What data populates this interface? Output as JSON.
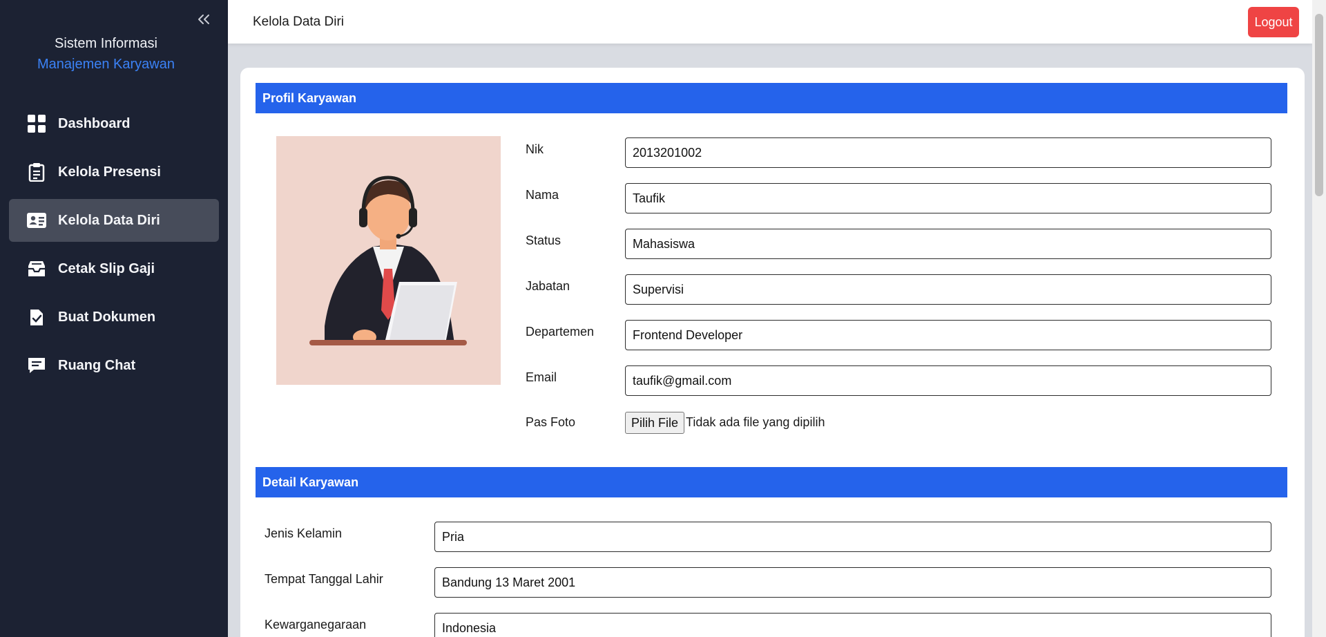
{
  "sidebar": {
    "collapse_icon": "double-chevron-left-icon",
    "brand_line1": "Sistem Informasi",
    "brand_line2": "Manajemen Karyawan",
    "items": [
      {
        "label": "Dashboard",
        "icon": "grid-icon",
        "active": false
      },
      {
        "label": "Kelola Presensi",
        "icon": "clipboard-icon",
        "active": false
      },
      {
        "label": "Kelola Data Diri",
        "icon": "id-card-icon",
        "active": true
      },
      {
        "label": "Cetak Slip Gaji",
        "icon": "inbox-tray-icon",
        "active": false
      },
      {
        "label": "Buat Dokumen",
        "icon": "document-check-icon",
        "active": false
      },
      {
        "label": "Ruang Chat",
        "icon": "chat-icon",
        "active": false
      }
    ]
  },
  "header": {
    "title": "Kelola Data Diri",
    "logout_label": "Logout"
  },
  "profile": {
    "section_title": "Profil Karyawan",
    "fields": {
      "nik": {
        "label": "Nik",
        "value": "2013201002"
      },
      "nama": {
        "label": "Nama",
        "value": "Taufik"
      },
      "status": {
        "label": "Status",
        "value": "Mahasiswa"
      },
      "jabatan": {
        "label": "Jabatan",
        "value": "Supervisi"
      },
      "departemen": {
        "label": "Departemen",
        "value": "Frontend Developer"
      },
      "email": {
        "label": "Email",
        "value": "taufik@gmail.com"
      }
    },
    "photo_field": {
      "label": "Pas Foto",
      "button_label": "Pilih File",
      "status_text": "Tidak ada file yang dipilih"
    }
  },
  "detail": {
    "section_title": "Detail Karyawan",
    "fields": {
      "jenis_kelamin": {
        "label": "Jenis Kelamin",
        "value": "Pria"
      },
      "ttl": {
        "label": "Tempat Tanggal Lahir",
        "value": "Bandung 13 Maret 2001"
      },
      "kewarganegaraan": {
        "label": "Kewarganegaraan",
        "value": "Indonesia"
      }
    }
  },
  "colors": {
    "sidebar_bg": "#1c2233",
    "accent_blue": "#2563eb",
    "brand_blue": "#3b82f6",
    "logout_red": "#ef4444",
    "active_item": "#474c5a"
  }
}
